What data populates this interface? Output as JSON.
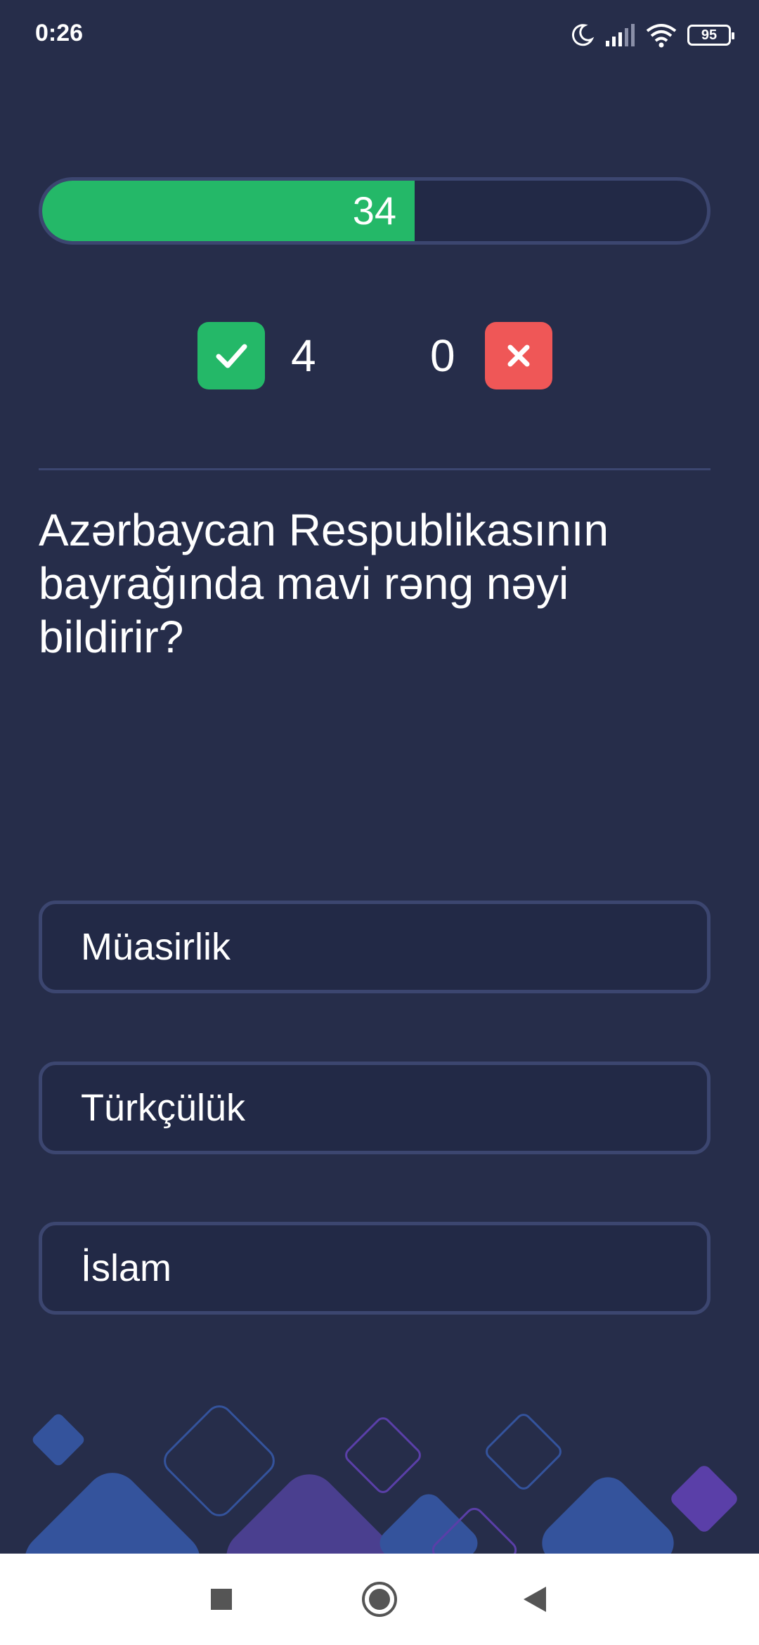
{
  "status_bar": {
    "time": "0:26",
    "battery": "95",
    "icons": [
      "moon-icon",
      "signal-icon",
      "wifi-icon",
      "battery-icon"
    ]
  },
  "progress": {
    "value_label": "34",
    "fraction": 0.56
  },
  "score": {
    "correct_count": "4",
    "wrong_count": "0",
    "correct_color": "#24b868",
    "wrong_color": "#ef5757"
  },
  "question": {
    "text": "Azərbaycan Respublikasının bayrağında mavi rəng nəyi bildirir?"
  },
  "options": [
    {
      "label": "Müasirlik"
    },
    {
      "label": "Türkçülük"
    },
    {
      "label": "İslam"
    }
  ],
  "colors": {
    "background": "#262d4a",
    "border": "#3c4670",
    "accent_green": "#24b868",
    "accent_red": "#ef5757"
  },
  "navigation": {
    "buttons": [
      "recents-square-icon",
      "home-circle-icon",
      "back-triangle-icon"
    ]
  }
}
